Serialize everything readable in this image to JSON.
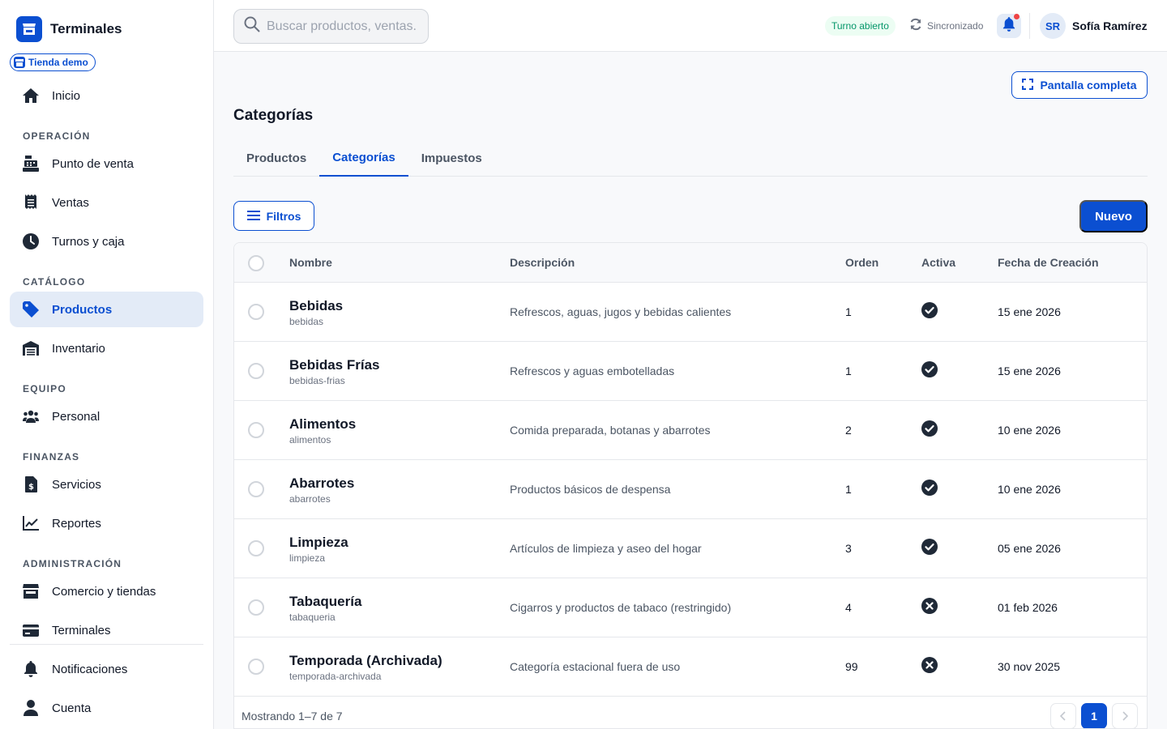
{
  "brand": {
    "name": "Terminales",
    "store": "Tienda demo"
  },
  "colors": {
    "accent": "#0b4fd1",
    "active_bg": "#e3ebf7",
    "success": "#059669",
    "alert": "#ef4444"
  },
  "sidebar": {
    "home": {
      "label": "Inicio",
      "icon": "home-icon"
    },
    "sections": [
      {
        "title": "OPERACIÓN",
        "items": [
          {
            "label": "Punto de venta",
            "icon": "cash-register-icon"
          },
          {
            "label": "Ventas",
            "icon": "receipt-icon"
          },
          {
            "label": "Turnos y caja",
            "icon": "clock-icon"
          }
        ]
      },
      {
        "title": "CATÁLOGO",
        "items": [
          {
            "label": "Productos",
            "icon": "tag-icon",
            "active": true
          },
          {
            "label": "Inventario",
            "icon": "warehouse-icon"
          }
        ]
      },
      {
        "title": "EQUIPO",
        "items": [
          {
            "label": "Personal",
            "icon": "users-icon"
          }
        ]
      },
      {
        "title": "FINANZAS",
        "items": [
          {
            "label": "Servicios",
            "icon": "invoice-dollar-icon"
          },
          {
            "label": "Reportes",
            "icon": "chart-line-icon"
          }
        ]
      },
      {
        "title": "ADMINISTRACIÓN",
        "items": [
          {
            "label": "Comercio y tiendas",
            "icon": "store-icon"
          },
          {
            "label": "Terminales",
            "icon": "credit-card-icon"
          }
        ]
      }
    ],
    "bottom": [
      {
        "label": "Notificaciones",
        "icon": "bell-icon"
      },
      {
        "label": "Cuenta",
        "icon": "user-icon"
      }
    ]
  },
  "header": {
    "search_placeholder": "Buscar productos, ventas...",
    "shift_status": "Turno abierto",
    "sync_status": "Sincronizado",
    "user_initials": "SR",
    "user_name": "Sofía Ramírez"
  },
  "main": {
    "fullscreen_label": "Pantalla completa",
    "title": "Categorías",
    "tabs": [
      {
        "label": "Productos",
        "active": false
      },
      {
        "label": "Categorías",
        "active": true
      },
      {
        "label": "Impuestos",
        "active": false
      }
    ],
    "filters_label": "Filtros",
    "new_label": "Nuevo",
    "table": {
      "columns": [
        "Nombre",
        "Descripción",
        "Orden",
        "Activa",
        "Fecha de Creación"
      ],
      "rows": [
        {
          "name": "Bebidas",
          "slug": "bebidas",
          "description": "Refrescos, aguas, jugos y bebidas calientes",
          "order": "1",
          "active": true,
          "created": "15 ene 2026"
        },
        {
          "name": "Bebidas Frías",
          "slug": "bebidas-frias",
          "description": "Refrescos y aguas embotelladas",
          "order": "1",
          "active": true,
          "created": "15 ene 2026"
        },
        {
          "name": "Alimentos",
          "slug": "alimentos",
          "description": "Comida preparada, botanas y abarrotes",
          "order": "2",
          "active": true,
          "created": "10 ene 2026"
        },
        {
          "name": "Abarrotes",
          "slug": "abarrotes",
          "description": "Productos básicos de despensa",
          "order": "1",
          "active": true,
          "created": "10 ene 2026"
        },
        {
          "name": "Limpieza",
          "slug": "limpieza",
          "description": "Artículos de limpieza y aseo del hogar",
          "order": "3",
          "active": true,
          "created": "05 ene 2026"
        },
        {
          "name": "Tabaquería",
          "slug": "tabaqueria",
          "description": "Cigarros y productos de tabaco (restringido)",
          "order": "4",
          "active": false,
          "created": "01 feb 2026"
        },
        {
          "name": "Temporada (Archivada)",
          "slug": "temporada-archivada",
          "description": "Categoría estacional fuera de uso",
          "order": "99",
          "active": false,
          "created": "30 nov 2025"
        }
      ]
    },
    "footer": {
      "showing": "Mostrando 1–7 de 7",
      "current_page": "1"
    }
  }
}
